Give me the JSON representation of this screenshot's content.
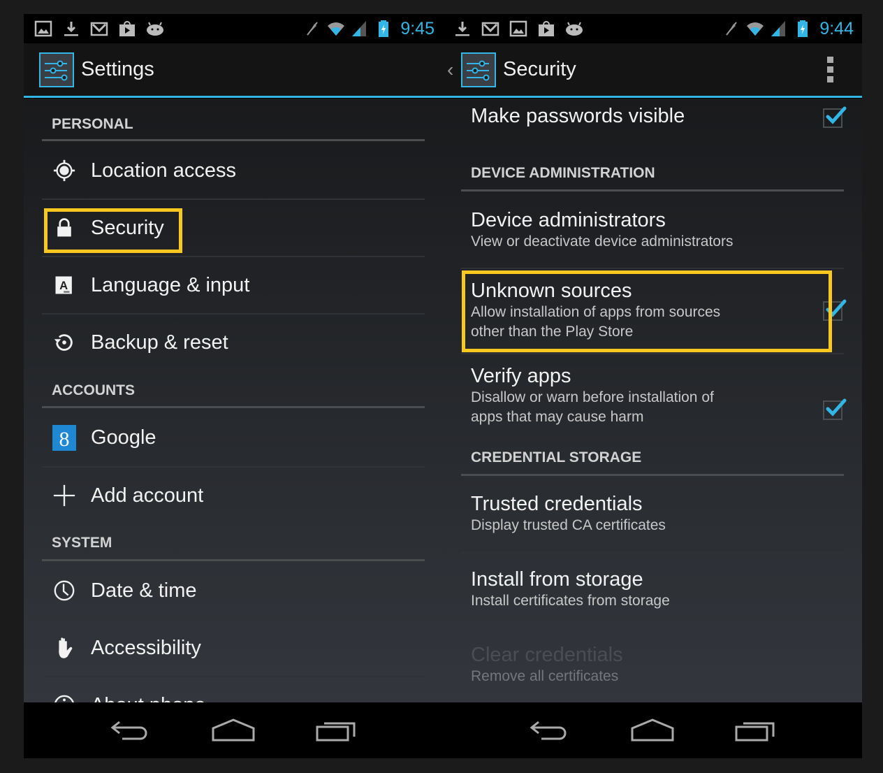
{
  "colors": {
    "accent": "#33b5e5",
    "highlight": "#f9c820",
    "background": "#1b1b1b"
  },
  "left_screen": {
    "statusbar": {
      "notification_icons": [
        "gallery-icon",
        "download-icon",
        "gmail-icon",
        "play-store-icon",
        "android-icon"
      ],
      "system_icons": [
        "mute-icon",
        "wifi-icon",
        "signal-icon",
        "battery-charging-icon"
      ],
      "time": "9:45"
    },
    "actionbar": {
      "title": "Settings",
      "icon": "settings-icon"
    },
    "sections": [
      {
        "header": "PERSONAL",
        "items": [
          {
            "label": "Location access",
            "icon": "location-icon"
          },
          {
            "label": "Security",
            "icon": "lock-icon",
            "highlighted": true
          },
          {
            "label": "Language & input",
            "icon": "language-icon"
          },
          {
            "label": "Backup & reset",
            "icon": "backup-icon"
          }
        ]
      },
      {
        "header": "ACCOUNTS",
        "items": [
          {
            "label": "Google",
            "icon": "google-icon"
          },
          {
            "label": "Add account",
            "icon": "plus-icon"
          }
        ]
      },
      {
        "header": "SYSTEM",
        "items": [
          {
            "label": "Date & time",
            "icon": "clock-icon"
          },
          {
            "label": "Accessibility",
            "icon": "hand-icon"
          },
          {
            "label": "About phone",
            "icon": "info-icon"
          }
        ]
      }
    ],
    "navbar": [
      "back-icon",
      "home-icon",
      "recents-icon"
    ]
  },
  "right_screen": {
    "statusbar": {
      "notification_icons": [
        "download-icon",
        "gmail-icon",
        "gallery-icon",
        "play-store-icon",
        "android-icon"
      ],
      "system_icons": [
        "mute-icon",
        "wifi-icon",
        "signal-icon",
        "battery-charging-icon"
      ],
      "time": "9:44"
    },
    "actionbar": {
      "title": "Security",
      "icon": "settings-icon",
      "up_caret": "‹"
    },
    "prefs": {
      "make_passwords_visible": {
        "title": "Make passwords visible",
        "checked": true
      },
      "device_admin_header": "DEVICE ADMINISTRATION",
      "device_administrators": {
        "title": "Device administrators",
        "summary": "View or deactivate device administrators"
      },
      "unknown_sources": {
        "title": "Unknown sources",
        "summary_line1": "Allow installation of apps from sources",
        "summary_line2": "other than the Play Store",
        "checked": true,
        "highlighted": true
      },
      "verify_apps": {
        "title": "Verify apps",
        "summary_line1": "Disallow or warn before installation of",
        "summary_line2": "apps that may cause harm",
        "checked": true
      },
      "credential_storage_header": "CREDENTIAL STORAGE",
      "trusted_credentials": {
        "title": "Trusted credentials",
        "summary": "Display trusted CA certificates"
      },
      "install_from_storage": {
        "title": "Install from storage",
        "summary": "Install certificates from storage"
      },
      "clear_credentials": {
        "title": "Clear credentials",
        "summary": "Remove all certificates",
        "disabled": true
      }
    },
    "navbar": [
      "back-icon",
      "home-icon",
      "recents-icon"
    ]
  }
}
